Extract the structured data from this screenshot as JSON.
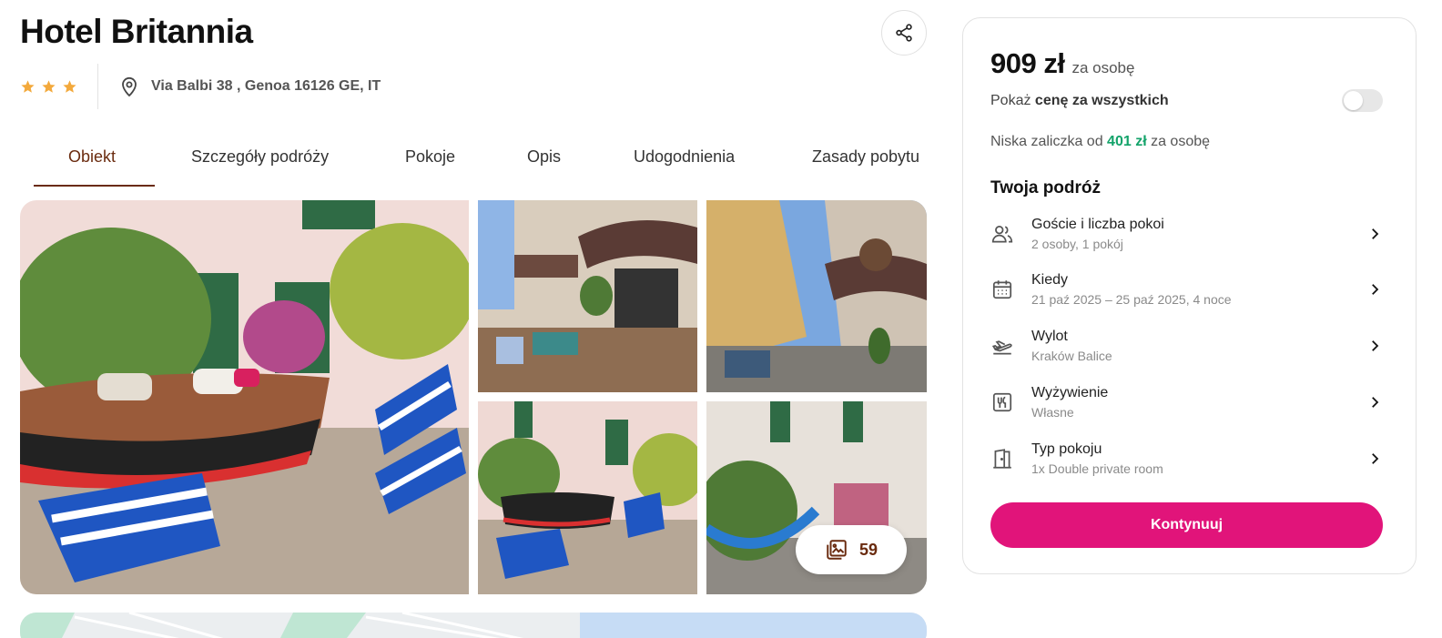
{
  "hotel": {
    "name": "Hotel Britannia",
    "stars": 3,
    "address": "Via Balbi 38 , Genoa 16126 GE, IT"
  },
  "tabs": [
    {
      "label": "Obiekt",
      "active": true
    },
    {
      "label": "Szczegóły podróży",
      "active": false
    },
    {
      "label": "Pokoje",
      "active": false
    },
    {
      "label": "Opis",
      "active": false
    },
    {
      "label": "Udogodnienia",
      "active": false
    },
    {
      "label": "Zasady pobytu",
      "active": false
    }
  ],
  "gallery": {
    "photo_count": "59"
  },
  "booking": {
    "price": "909 zł",
    "per_person": "za osobę",
    "toggle_prefix": "Pokaż ",
    "toggle_bold": "cenę za wszystkich",
    "toggle_on": false,
    "deposit_prefix": "Niska zaliczka od ",
    "deposit_amount": "401 zł",
    "deposit_suffix": " za osobę",
    "trip_heading": "Twoja podróż",
    "trip_items": [
      {
        "icon": "guests-icon",
        "title": "Goście i liczba pokoi",
        "subtitle": "2 osoby, 1 pokój"
      },
      {
        "icon": "calendar-icon",
        "title": "Kiedy",
        "subtitle": "21 paź 2025 – 25 paź 2025, 4 noce"
      },
      {
        "icon": "plane-departure-icon",
        "title": "Wylot",
        "subtitle": "Kraków Balice"
      },
      {
        "icon": "cutlery-icon",
        "title": "Wyżywienie",
        "subtitle": "Własne"
      },
      {
        "icon": "door-icon",
        "title": "Typ pokoju",
        "subtitle": "1x Double private room"
      }
    ],
    "cta_label": "Kontynuuj"
  },
  "colors": {
    "accent_brown": "#6a2b0f",
    "cta_pink": "#e1147a",
    "deposit_green": "#13a36a",
    "star_gold": "#f3a93c"
  }
}
